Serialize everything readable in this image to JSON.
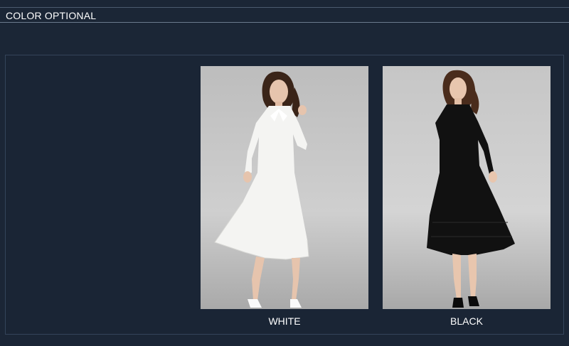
{
  "section": {
    "title": "COLOR OPTIONAL"
  },
  "products": [
    {
      "label": "WHITE",
      "dress_color": "#f4f4f2"
    },
    {
      "label": "BLACK",
      "dress_color": "#111111"
    }
  ],
  "colors": {
    "background": "#1b2636",
    "text": "#ffffff"
  }
}
